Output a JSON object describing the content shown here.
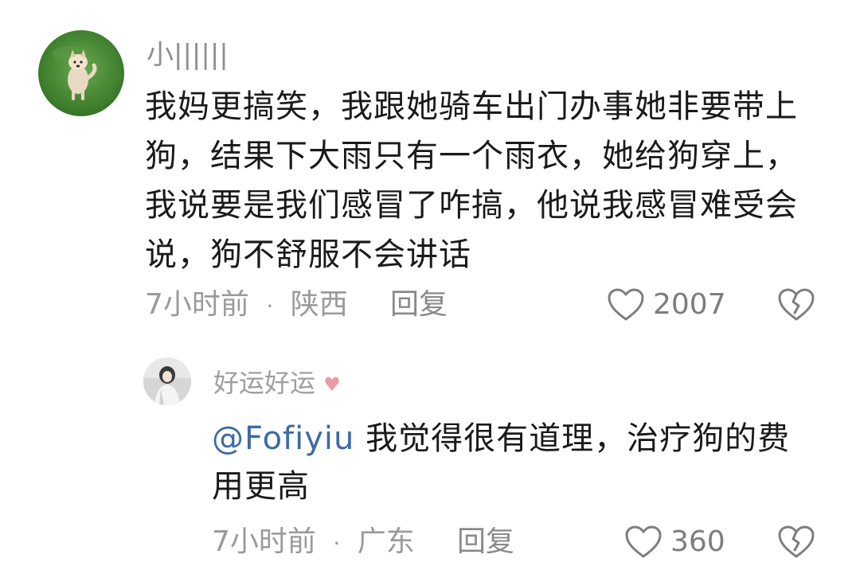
{
  "comment": {
    "username": "小||||||",
    "text": "我妈更搞笑，我跟她骑车出门办事她非要带上狗，结果下大雨只有一个雨衣，她给狗穿上，我说要是我们感冒了咋搞，他说我感冒难受会说，狗不舒服不会讲话",
    "time": "7小时前",
    "dot": "·",
    "location": "陕西",
    "reply_label": "回复",
    "likes": "2007"
  },
  "reply": {
    "username": "好运​好运",
    "mention": "@Fofiyiu",
    "text": " 我觉得很有道理，治疗狗的费用更高",
    "time": "7小时前",
    "dot": "·",
    "location": "广东",
    "reply_label": "回复",
    "likes": "360"
  },
  "icons": {
    "like": "heart-outline-icon",
    "dislike": "broken-heart-icon"
  },
  "colors": {
    "text": "#1a1a1a",
    "meta": "#9a9a9a",
    "mention": "#3c6aa6"
  }
}
